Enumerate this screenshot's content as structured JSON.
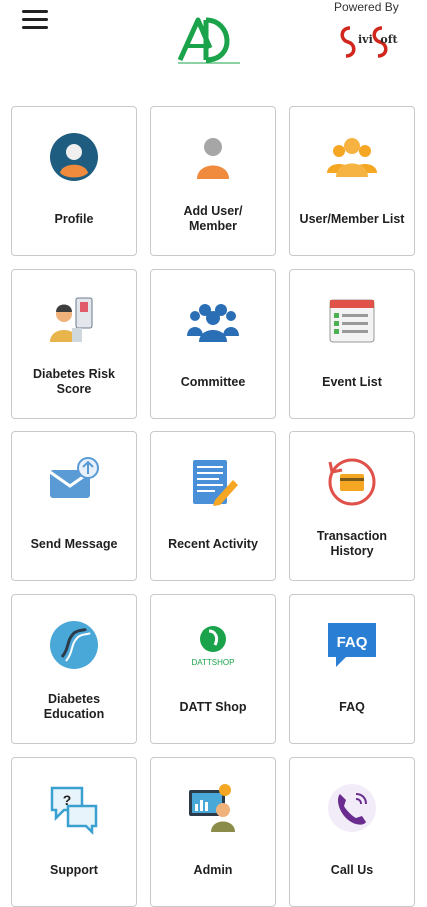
{
  "header": {
    "powered_by": "Powered By",
    "sponsor_name": "SiviSoft"
  },
  "tiles": [
    {
      "label": "Profile",
      "icon": "profile-icon"
    },
    {
      "label": "Add User/\nMember",
      "icon": "add-user-icon"
    },
    {
      "label": "User/Member List",
      "icon": "user-list-icon"
    },
    {
      "label": "Diabetes Risk\nScore",
      "icon": "diabetes-risk-icon"
    },
    {
      "label": "Committee",
      "icon": "committee-icon"
    },
    {
      "label": "Event List",
      "icon": "event-list-icon"
    },
    {
      "label": "Send Message",
      "icon": "send-message-icon"
    },
    {
      "label": "Recent Activity",
      "icon": "recent-activity-icon"
    },
    {
      "label": "Transaction\nHistory",
      "icon": "transaction-history-icon"
    },
    {
      "label": "Diabetes\nEducation",
      "icon": "diabetes-education-icon"
    },
    {
      "label": "DATT Shop",
      "icon": "datt-shop-icon"
    },
    {
      "label": "FAQ",
      "icon": "faq-icon"
    },
    {
      "label": "Support",
      "icon": "support-icon"
    },
    {
      "label": "Admin",
      "icon": "admin-icon"
    },
    {
      "label": "Call Us",
      "icon": "call-us-icon"
    }
  ],
  "colors": {
    "brand_green": "#1aa34a",
    "card_border": "#c9c9c9",
    "icon_blue": "#2a7fd4",
    "icon_orange": "#f5a623"
  }
}
